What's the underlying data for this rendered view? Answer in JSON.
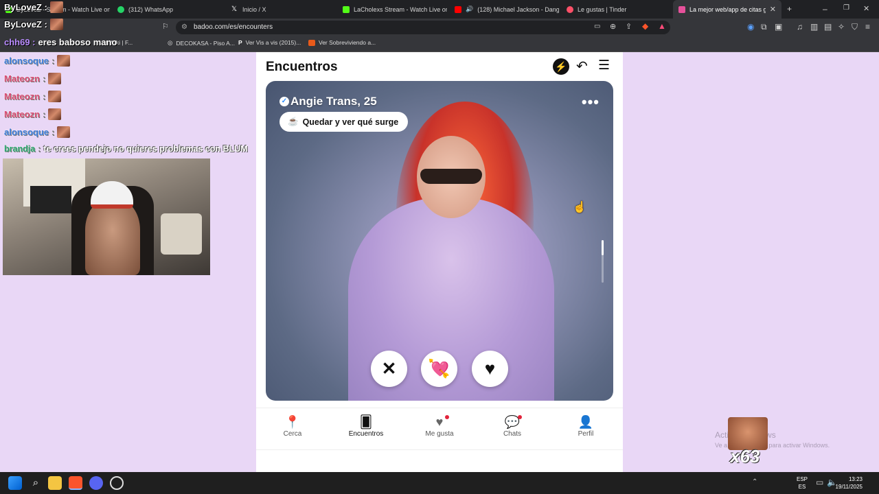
{
  "browser": {
    "tabs": [
      {
        "label": "ByLoveZ - Stream - Watch Live on Ki",
        "color": "#53fc18"
      },
      {
        "label": "(312) WhatsApp",
        "color": "#25d366"
      },
      {
        "label": "Inicio / X",
        "color": "#ffffff"
      },
      {
        "label": "LaCholexs Stream - Watch Live on Ki",
        "color": "#53fc18"
      },
      {
        "label": "(128) Michael Jackson - Dangero",
        "color": "#ff0000"
      },
      {
        "label": "Le gustas | Tinder",
        "color": "#fd5068"
      },
      {
        "label": "La mejor web/app de citas gratis",
        "color": "#e6519b"
      }
    ],
    "url": "badoo.com/es/encounters",
    "bookmarks": [
      "st Wiki | F...",
      "DECOKASA - Piso A...",
      "Ver Vis a vis (2015)...",
      "Ver Sobreviviendo a..."
    ]
  },
  "overlay": {
    "streamer_tag": "ByLoveZ :",
    "top_message_user": "ByLoveZ :",
    "msg_user": "chh69 :",
    "msg_text": "eres baboso mano",
    "chat": [
      {
        "user": "alonsoque",
        "text": "",
        "color": "#3c7bd9"
      },
      {
        "user": "Mateozn",
        "text": "",
        "color": "#d94b72"
      },
      {
        "user": "Mateozn",
        "text": "",
        "color": "#d94b72"
      },
      {
        "user": "Mateozn",
        "text": "",
        "color": "#d94b72"
      },
      {
        "user": "alonsoque",
        "text": "",
        "color": "#3c7bd9"
      },
      {
        "user": "brandja",
        "text": "te crees pendejo no quieres problemas con BLUM",
        "color": "#2aa36c"
      }
    ]
  },
  "page": {
    "title": "Encuentros",
    "profile": {
      "name": "Angie Trans, 25",
      "chip": "Quedar y ver qué surge"
    },
    "nav": [
      {
        "label": "Cerca",
        "icon": "location-pin-icon",
        "active": false,
        "dot": false
      },
      {
        "label": "Encuentros",
        "icon": "cards-icon",
        "active": true,
        "dot": false
      },
      {
        "label": "Me gusta",
        "icon": "hearts-icon",
        "active": false,
        "dot": true
      },
      {
        "label": "Chats",
        "icon": "chat-bubbles-icon",
        "active": false,
        "dot": true
      },
      {
        "label": "Perfil",
        "icon": "user-icon",
        "active": false,
        "dot": false
      }
    ]
  },
  "watermark": {
    "line1": "Activar Windows",
    "line2": "Ve a Configuración para activar Windows."
  },
  "emote_count": "x63",
  "taskbar": {
    "lang1": "ESP",
    "lang2": "ES",
    "time": "13:23",
    "date": "19/11/2025"
  }
}
